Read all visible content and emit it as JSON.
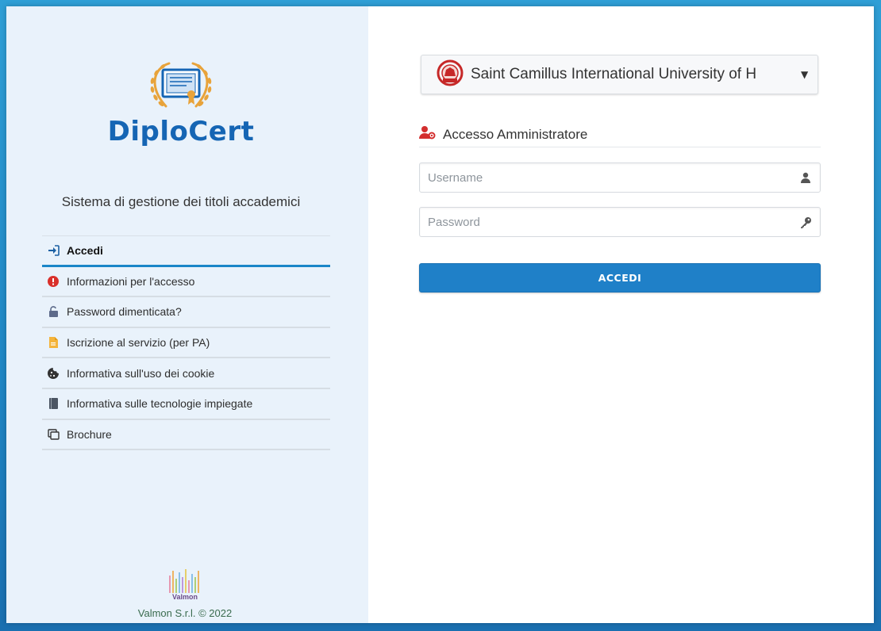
{
  "brand": {
    "name": "DiploCert"
  },
  "left": {
    "subtitle": "Sistema di gestione dei titoli accademici",
    "menu": [
      {
        "label": "Accedi",
        "icon": "sign-in-icon",
        "active": true
      },
      {
        "label": "Informazioni per l'accesso",
        "icon": "info-icon"
      },
      {
        "label": "Password dimenticata?",
        "icon": "unlock-icon"
      },
      {
        "label": "Iscrizione al servizio (per PA)",
        "icon": "document-icon"
      },
      {
        "label": "Informativa sull'uso dei cookie",
        "icon": "cookie-icon"
      },
      {
        "label": "Informativa sulle tecnologie impiegate",
        "icon": "book-icon"
      },
      {
        "label": "Brochure",
        "icon": "copy-icon"
      }
    ],
    "footer": {
      "logo_text": "Valmon",
      "text": "Valmon S.r.l. © 2022"
    }
  },
  "right": {
    "university_selector": {
      "value": "Saint Camillus International University of H"
    },
    "section_title": "Accesso Amministratore",
    "username": {
      "value": "",
      "placeholder": "Username"
    },
    "password": {
      "value": "",
      "placeholder": "Password"
    },
    "login_button": "ACCEDI"
  },
  "colors": {
    "brand_blue": "#1565b4",
    "accent_blue": "#1f80c8",
    "laurel_gold": "#e8a33a",
    "alert_red": "#d9302b",
    "background": "#1f86c4"
  }
}
